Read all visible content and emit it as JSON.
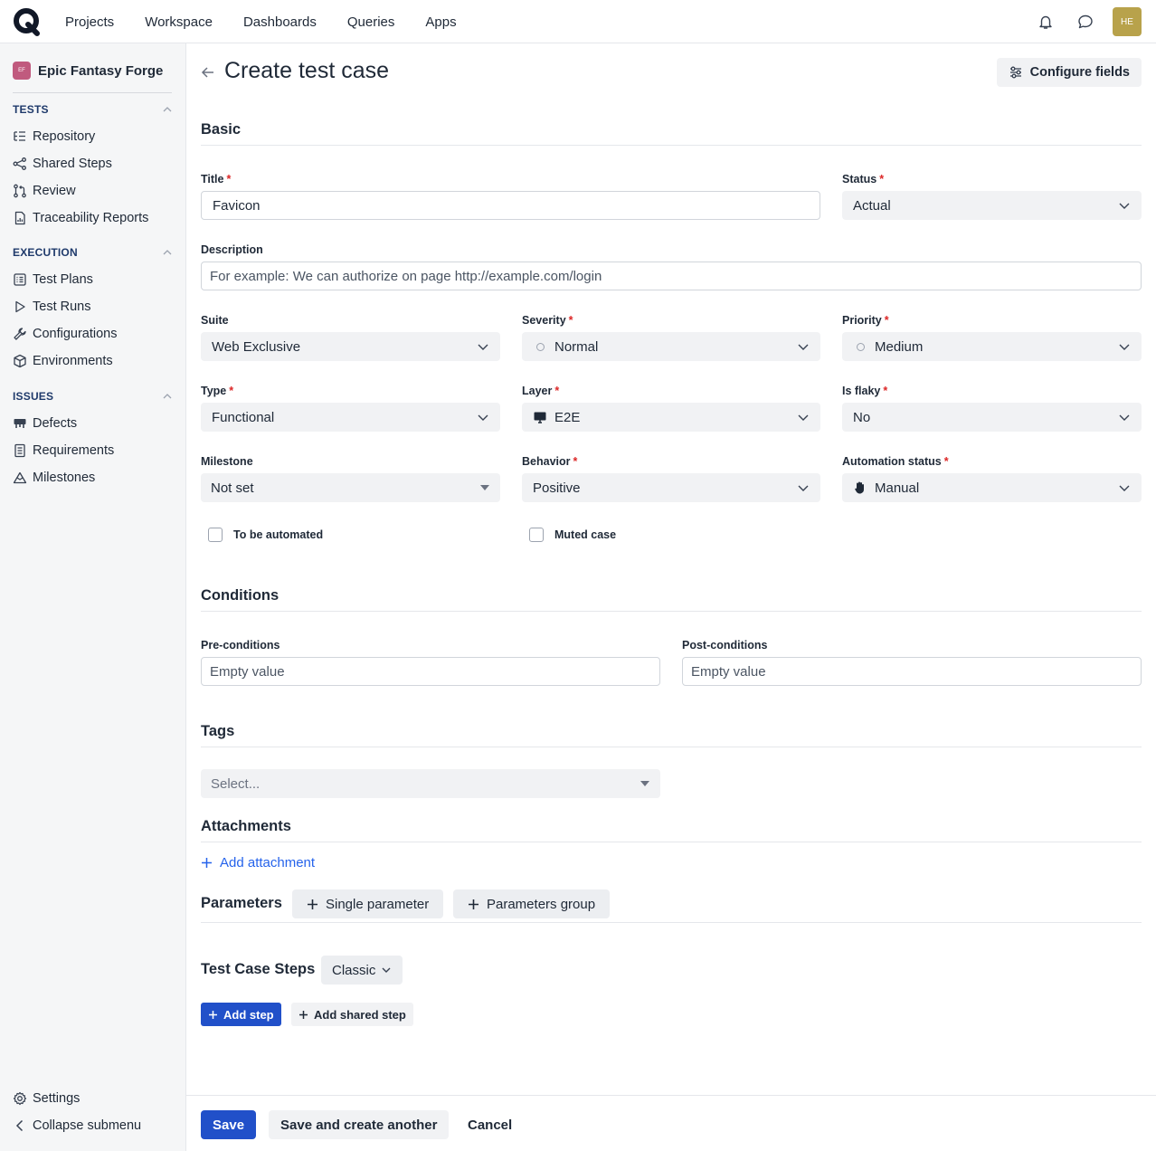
{
  "topnav": {
    "logo_icon": "q-logo-icon",
    "items": [
      "Projects",
      "Workspace",
      "Dashboards",
      "Queries",
      "Apps"
    ],
    "avatar_initials": "HE"
  },
  "sidebar": {
    "project": {
      "badge": "EF",
      "name": "Epic Fantasy Forge"
    },
    "tests_title": "TESTS",
    "tests": [
      "Repository",
      "Shared Steps",
      "Review",
      "Traceability Reports"
    ],
    "execution_title": "EXECUTION",
    "execution": [
      "Test Plans",
      "Test Runs",
      "Configurations",
      "Environments"
    ],
    "issues_title": "ISSUES",
    "issues": [
      "Defects",
      "Requirements",
      "Milestones"
    ],
    "settings": "Settings",
    "collapse": "Collapse submenu"
  },
  "page": {
    "title": "Create test case",
    "configure_fields": "Configure fields"
  },
  "basic": {
    "section_title": "Basic",
    "title_label": "Title",
    "title_value": "Favicon",
    "status_label": "Status",
    "status_value": "Actual",
    "description_label": "Description",
    "description_placeholder": "For example: We can authorize on page http://example.com/login",
    "suite_label": "Suite",
    "suite_value": "Web Exclusive",
    "severity_label": "Severity",
    "severity_value": "Normal",
    "priority_label": "Priority",
    "priority_value": "Medium",
    "type_label": "Type",
    "type_value": "Functional",
    "layer_label": "Layer",
    "layer_value": "E2E",
    "flaky_label": "Is flaky",
    "flaky_value": "No",
    "milestone_label": "Milestone",
    "milestone_value": "Not set",
    "behavior_label": "Behavior",
    "behavior_value": "Positive",
    "automation_label": "Automation status",
    "automation_value": "Manual",
    "to_be_automated": "To be automated",
    "muted_case": "Muted case"
  },
  "conditions": {
    "section_title": "Conditions",
    "pre_label": "Pre-conditions",
    "pre_placeholder": "Empty value",
    "post_label": "Post-conditions",
    "post_placeholder": "Empty value"
  },
  "tags": {
    "section_title": "Tags",
    "placeholder": "Select..."
  },
  "attachments": {
    "section_title": "Attachments",
    "add_label": "Add attachment"
  },
  "parameters": {
    "section_title": "Parameters",
    "single": "Single parameter",
    "group": "Parameters group"
  },
  "steps": {
    "section_title": "Test Case Steps",
    "mode": "Classic",
    "add_step": "Add step",
    "add_shared_step": "Add shared step"
  },
  "footer": {
    "save": "Save",
    "save_another": "Save and create another",
    "cancel": "Cancel"
  },
  "colors": {
    "primary": "#2150c9",
    "link": "#2563eb",
    "required": "#dc2626",
    "avatar": "#b8a24b",
    "project_badge": "#c05a7e"
  }
}
